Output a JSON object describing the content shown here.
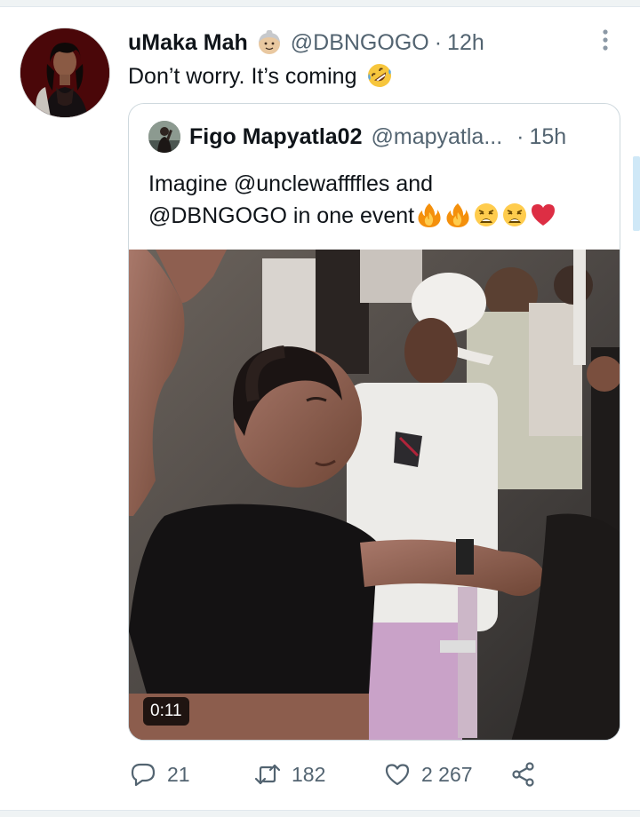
{
  "tweet": {
    "author_name": "uMaka Mah",
    "author_badge_icon": "older-woman-emoji",
    "handle": "@DBNGOGO",
    "separator": "·",
    "time": "12h",
    "text": "Don’t worry. It’s coming",
    "text_emoji": "rolling-on-floor-laughing-emoji",
    "more_icon": "vertical-ellipsis-icon"
  },
  "quote": {
    "author_name": "Figo Mapyatla02",
    "handle": "@mapyatla...",
    "separator": "·",
    "time": "15h",
    "text_line1": "Imagine @unclewaffffles  and",
    "text_line2": "@DBNGOGO in one event",
    "emojis": [
      "fire-emoji",
      "fire-emoji",
      "weary-face-emoji",
      "weary-face-emoji",
      "red-heart-emoji"
    ],
    "video": {
      "duration": "0:11"
    }
  },
  "actions": {
    "reply_count": "21",
    "retweet_count": "182",
    "like_count": "2 267",
    "icons": [
      "reply-icon",
      "retweet-icon",
      "like-icon",
      "share-icon"
    ]
  },
  "colors": {
    "text_primary": "#0f1419",
    "text_secondary": "#536471",
    "border": "#cfd9de",
    "heart_red": "#e0245e"
  }
}
